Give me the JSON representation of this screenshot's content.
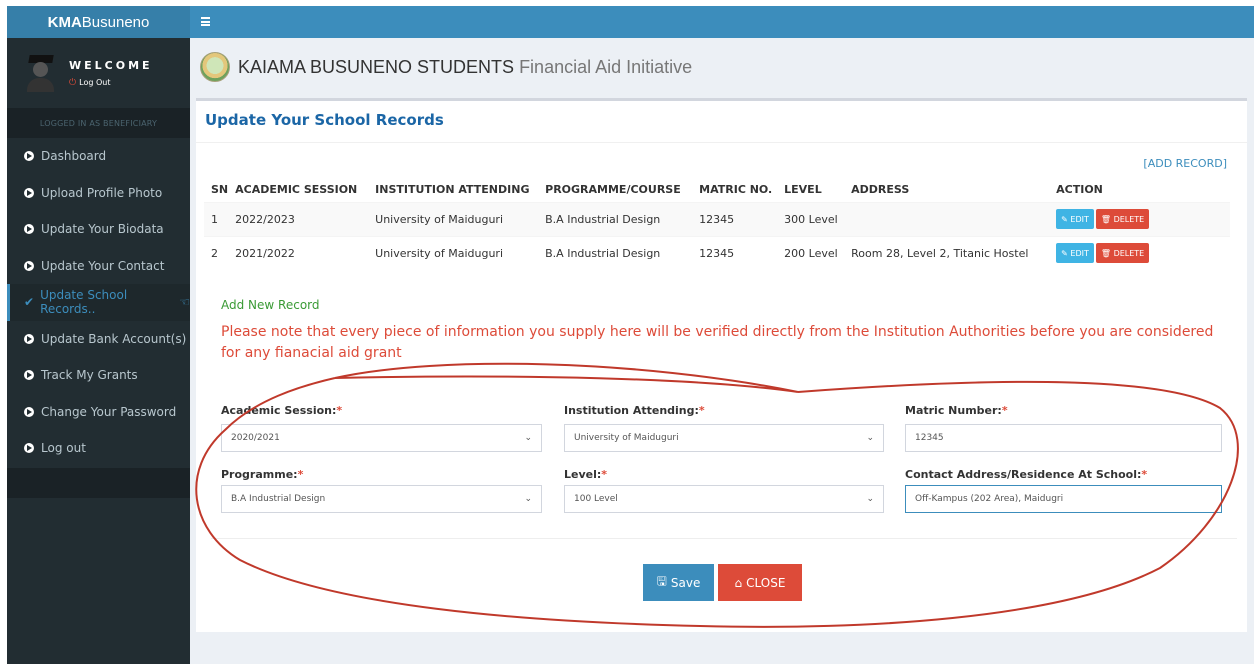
{
  "brand": {
    "bold": "KMA",
    "rest": "Busuneno"
  },
  "user": {
    "welcome": "WELCOME",
    "logout": "Log Out"
  },
  "sidebar": {
    "header": "LOGGED IN AS BENEFICIARY",
    "items": [
      {
        "label": "Dashboard"
      },
      {
        "label": "Upload Profile Photo"
      },
      {
        "label": "Update Your Biodata"
      },
      {
        "label": "Update Your Contact"
      },
      {
        "label": "Update School Records.."
      },
      {
        "label": "Update Bank Account(s)"
      },
      {
        "label": "Track My Grants"
      },
      {
        "label": "Change Your Password"
      },
      {
        "label": "Log out"
      }
    ]
  },
  "header": {
    "title_bold": "KAIAMA BUSUNENO STUDENTS",
    "title_sub": "Financial Aid Initiative"
  },
  "panel": {
    "title": "Update Your School Records"
  },
  "table": {
    "add_record": "[ADD RECORD]",
    "columns": [
      "SN",
      "ACADEMIC SESSION",
      "INSTITUTION ATTENDING",
      "PROGRAMME/COURSE",
      "MATRIC NO.",
      "LEVEL",
      "ADDRESS",
      "ACTION"
    ],
    "rows": [
      {
        "sn": "1",
        "session": "2022/2023",
        "institution": "University of Maiduguri",
        "programme": "B.A Industrial Design",
        "matric": "12345",
        "level": "300 Level",
        "address": ""
      },
      {
        "sn": "2",
        "session": "2021/2022",
        "institution": "University of Maiduguri",
        "programme": "B.A Industrial Design",
        "matric": "12345",
        "level": "200 Level",
        "address": "Room 28, Level 2, Titanic Hostel"
      }
    ],
    "edit_label": "EDIT",
    "delete_label": "DELETE"
  },
  "form": {
    "title": "Add New Record",
    "note": "Please note that every piece of information you supply here will be verified directly from the Institution Authorities before you are considered for any fianacial aid grant",
    "academic_session": {
      "label": "Academic Session:",
      "value": "2020/2021"
    },
    "institution": {
      "label": "Institution Attending:",
      "value": "University of Maiduguri"
    },
    "matric": {
      "label": "Matric Number:",
      "value": "12345"
    },
    "programme": {
      "label": "Programme:",
      "value": "B.A Industrial Design"
    },
    "level": {
      "label": "Level:",
      "value": "100 Level"
    },
    "address": {
      "label": "Contact Address/Residence At School:",
      "value": "Off-Kampus (202 Area), Maidugri"
    },
    "required_mark": "*",
    "save_label": "Save",
    "close_label": "CLOSE"
  },
  "colors": {
    "topbar": "#3c8dbc",
    "sidebar": "#222d32",
    "title": "#1b66a6",
    "danger": "#dd4b39",
    "success": "#3a9a35",
    "annotation": "#c0392b"
  }
}
